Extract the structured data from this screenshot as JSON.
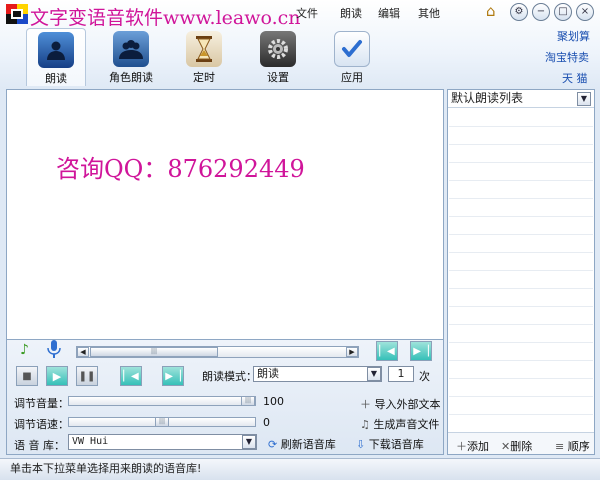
{
  "app": {
    "title": "文字变语音软件www.leawo.cn"
  },
  "menu": [
    "文件",
    "朗读",
    "编辑",
    "其他"
  ],
  "window_buttons": {
    "home": "⌂",
    "skin": "⚙",
    "minimize": "−",
    "maximize": "□",
    "close": "×"
  },
  "side_links": [
    "聚划算",
    "淘宝特卖",
    "天 猫"
  ],
  "toolbar": [
    {
      "label": "朗读",
      "icon": "user-icon",
      "color": "#1e5aa8"
    },
    {
      "label": "角色朗读",
      "icon": "users-icon",
      "color": "#2a5d9a"
    },
    {
      "label": "定时",
      "icon": "hourglass-icon",
      "color": "#b27a2c"
    },
    {
      "label": "设置",
      "icon": "gear-icon",
      "color": "#4a4a4a"
    },
    {
      "label": "应用",
      "icon": "checkmark-icon",
      "color": "#2d6ed0"
    }
  ],
  "editor": {
    "watermark": "咨询QQ：876292449"
  },
  "list": {
    "selected": "默认朗读列表",
    "add": "添加",
    "delete": "删除",
    "order": "顺序"
  },
  "playback": {
    "mode_label": "朗读模式：",
    "mode_value": "朗读",
    "repeat_count": "1",
    "repeat_unit": "次"
  },
  "volume": {
    "label": "调节音量：",
    "value": "100",
    "level": 1.0
  },
  "speed": {
    "label": "调节语速：",
    "value": "0",
    "level": 0.5
  },
  "voice": {
    "label": "语 音 库：",
    "value": "VW Hui",
    "refresh": "刷新语音库",
    "download": "下载语音库"
  },
  "actions": {
    "import": "导入外部文本",
    "generate": "生成声音文件"
  },
  "status": {
    "text": "单击本下拉菜单选择用来朗读的语音库!"
  },
  "colors": {
    "accent_magenta": "#d0159a",
    "link_blue": "#1a4fb0",
    "teal_button": "#36c0b8"
  }
}
